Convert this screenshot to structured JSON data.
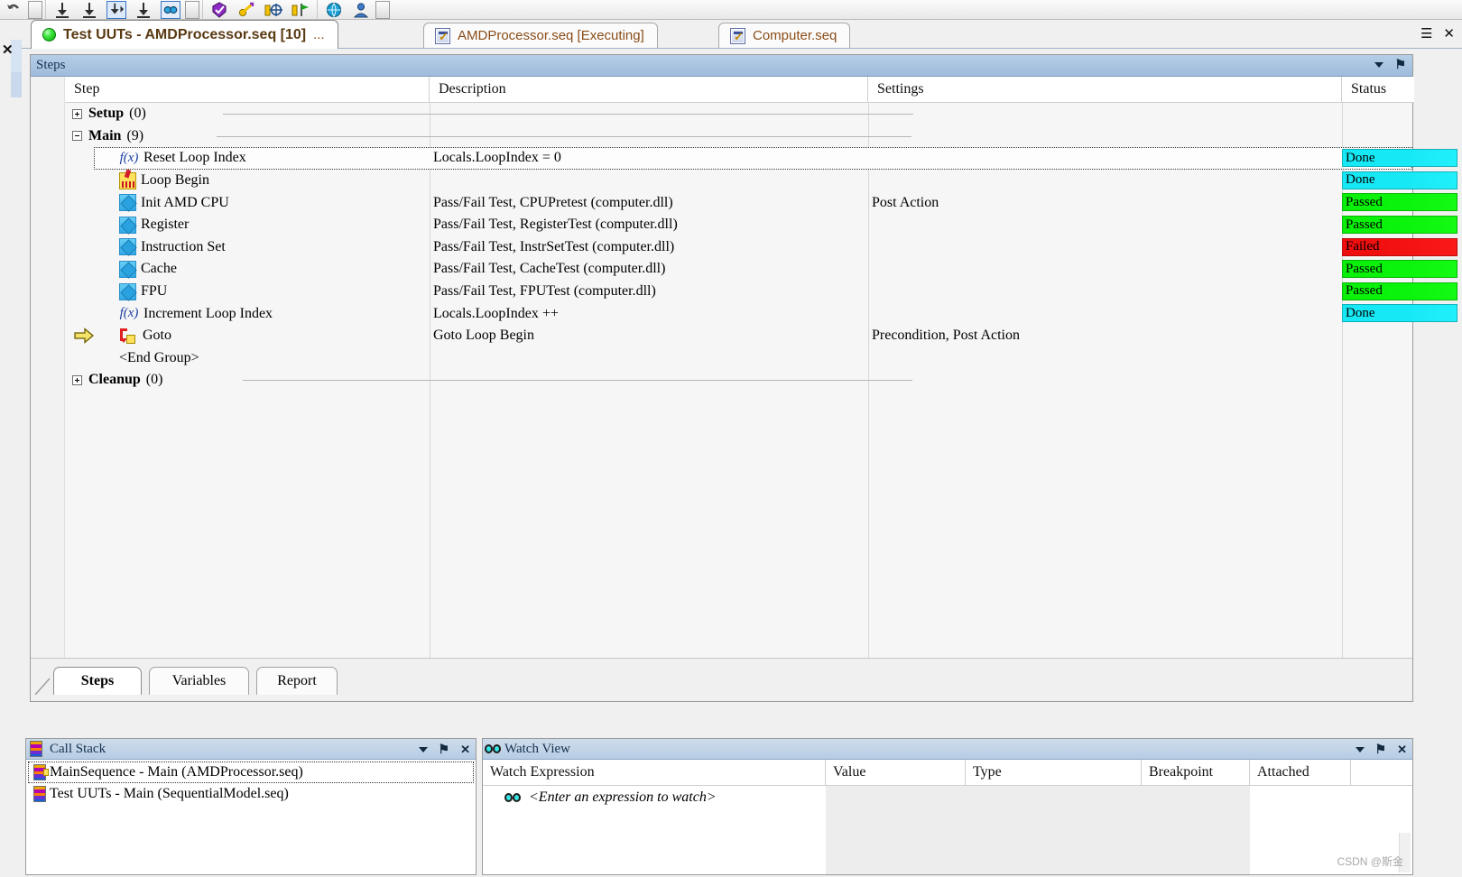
{
  "toolbar": {
    "items": [
      {
        "name": "undo-icon",
        "glyph": "↶"
      },
      {
        "name": "undo-dropdown-icon",
        "glyph": "▼"
      },
      {
        "name": "separator-1",
        "glyph": ""
      },
      {
        "name": "step-into-icon",
        "glyph": "⤓"
      },
      {
        "name": "step-over-icon",
        "glyph": "⤓"
      },
      {
        "name": "step-out-icon",
        "glyph": "⤓"
      },
      {
        "name": "break-icon",
        "glyph": "⤓"
      },
      {
        "name": "watch-icon",
        "glyph": "◎"
      },
      {
        "name": "watch-dropdown-icon",
        "glyph": "▼"
      },
      {
        "name": "separator-2",
        "glyph": ""
      },
      {
        "name": "badge-icon",
        "glyph": "⬟"
      },
      {
        "name": "key-icon",
        "glyph": "⚿"
      },
      {
        "name": "insert-target-icon",
        "glyph": "⊕"
      },
      {
        "name": "flag-icon",
        "glyph": "⚑"
      },
      {
        "name": "separator-3",
        "glyph": ""
      },
      {
        "name": "globe-icon",
        "glyph": "ἱ0"
      },
      {
        "name": "user-icon",
        "glyph": "☺"
      },
      {
        "name": "user-dropdown-icon",
        "glyph": "▼"
      }
    ]
  },
  "window": {
    "close_label": "✕"
  },
  "doc_tabs": {
    "tabs": [
      {
        "label": "Test UUTs - AMDProcessor.seq [10]",
        "suffix": "...",
        "icon": "green-led-icon",
        "active": true
      },
      {
        "label": "AMDProcessor.seq [Executing]",
        "suffix": "",
        "icon": "sequence-file-icon",
        "active": false
      },
      {
        "label": "Computer.seq",
        "suffix": "",
        "icon": "sequence-file-icon",
        "active": false
      }
    ],
    "controls": {
      "menu": "☰",
      "close": "✕"
    }
  },
  "steps_pane": {
    "title": "Steps",
    "controls": {
      "dropdown": "▼",
      "pin": "⚑"
    },
    "columns": [
      "Step",
      "Description",
      "Settings",
      "Status"
    ],
    "rows": [
      {
        "kind": "group",
        "indent": 0,
        "expander": "plus",
        "step": "Setup",
        "count": "(0)",
        "desc": "",
        "settings": "",
        "status": "",
        "status_kind": "",
        "selected": false,
        "current": false
      },
      {
        "kind": "group",
        "indent": 0,
        "expander": "minus",
        "step": "Main",
        "count": "(9)",
        "desc": "",
        "settings": "",
        "status": "",
        "status_kind": "",
        "selected": false,
        "current": false
      },
      {
        "kind": "step",
        "indent": 1,
        "icon": "expression-fx-icon",
        "step": "Reset Loop Index",
        "desc": "Locals.LoopIndex = 0",
        "settings": "",
        "status": "Done",
        "status_kind": "done",
        "selected": true,
        "current": false
      },
      {
        "kind": "step",
        "indent": 1,
        "icon": "label-marker-icon",
        "step": "Loop Begin",
        "desc": "",
        "settings": "",
        "status": "Done",
        "status_kind": "done",
        "selected": false,
        "current": false
      },
      {
        "kind": "step",
        "indent": 1,
        "icon": "test-step-icon",
        "step": "Init AMD CPU",
        "desc": "Pass/Fail Test,  CPUPretest (computer.dll)",
        "settings": "Post Action",
        "status": "Passed",
        "status_kind": "passed",
        "selected": false,
        "current": false
      },
      {
        "kind": "step",
        "indent": 1,
        "icon": "test-step-icon",
        "step": "Register",
        "desc": "Pass/Fail Test,  RegisterTest (computer.dll)",
        "settings": "",
        "status": "Passed",
        "status_kind": "passed",
        "selected": false,
        "current": false
      },
      {
        "kind": "step",
        "indent": 1,
        "icon": "test-step-icon",
        "step": "Instruction Set",
        "desc": "Pass/Fail Test,  InstrSetTest (computer.dll)",
        "settings": "",
        "status": "Failed",
        "status_kind": "failed",
        "selected": false,
        "current": false
      },
      {
        "kind": "step",
        "indent": 1,
        "icon": "test-step-icon",
        "step": "Cache",
        "desc": "Pass/Fail Test,  CacheTest (computer.dll)",
        "settings": "",
        "status": "Passed",
        "status_kind": "passed",
        "selected": false,
        "current": false
      },
      {
        "kind": "step",
        "indent": 1,
        "icon": "test-step-icon",
        "step": "FPU",
        "desc": "Pass/Fail Test,  FPUTest (computer.dll)",
        "settings": "",
        "status": "Passed",
        "status_kind": "passed",
        "selected": false,
        "current": false
      },
      {
        "kind": "step",
        "indent": 1,
        "icon": "expression-fx-icon",
        "step": "Increment Loop Index",
        "desc": "Locals.LoopIndex ++",
        "settings": "",
        "status": "Done",
        "status_kind": "done",
        "selected": false,
        "current": false
      },
      {
        "kind": "step",
        "indent": 1,
        "icon": "goto-icon",
        "step": "Goto",
        "desc": "Goto Loop Begin",
        "settings": "Precondition, Post Action",
        "status": "",
        "status_kind": "",
        "selected": false,
        "current": true
      },
      {
        "kind": "step",
        "indent": 1,
        "icon": "none",
        "step": "<End Group>",
        "desc": "",
        "settings": "",
        "status": "",
        "status_kind": "",
        "selected": false,
        "current": false
      },
      {
        "kind": "group",
        "indent": 0,
        "expander": "plus",
        "step": "Cleanup",
        "count": "(0)",
        "desc": "",
        "settings": "",
        "status": "",
        "status_kind": "",
        "selected": false,
        "current": false
      }
    ],
    "sub_tabs": [
      {
        "label": "Steps",
        "active": true
      },
      {
        "label": "Variables",
        "active": false
      },
      {
        "label": "Report",
        "active": false
      }
    ]
  },
  "call_stack": {
    "title": "Call Stack",
    "icon": "call-stack-icon",
    "controls": {
      "dropdown": "▼",
      "pin": "⚑",
      "close": "✕"
    },
    "rows": [
      {
        "label": "MainSequence - Main (AMDProcessor.seq)",
        "selected": true
      },
      {
        "label": "Test UUTs - Main (SequentialModel.seq)",
        "selected": false
      }
    ]
  },
  "watch_view": {
    "title": "Watch View",
    "icon": "binoculars-icon",
    "controls": {
      "dropdown": "▼",
      "pin": "⚑",
      "close": "✕"
    },
    "columns": [
      "Watch Expression",
      "Value",
      "Type",
      "Breakpoint",
      "Attached"
    ],
    "placeholder_row": "<Enter an expression to watch>"
  },
  "watermark": "CSDN @斯金",
  "colors": {
    "status_done": "#17e8f5",
    "status_passed": "#09ef09",
    "status_failed": "#ef0d0d",
    "panel_title": "#b6cde6",
    "tab_text": "#8a4d18"
  }
}
